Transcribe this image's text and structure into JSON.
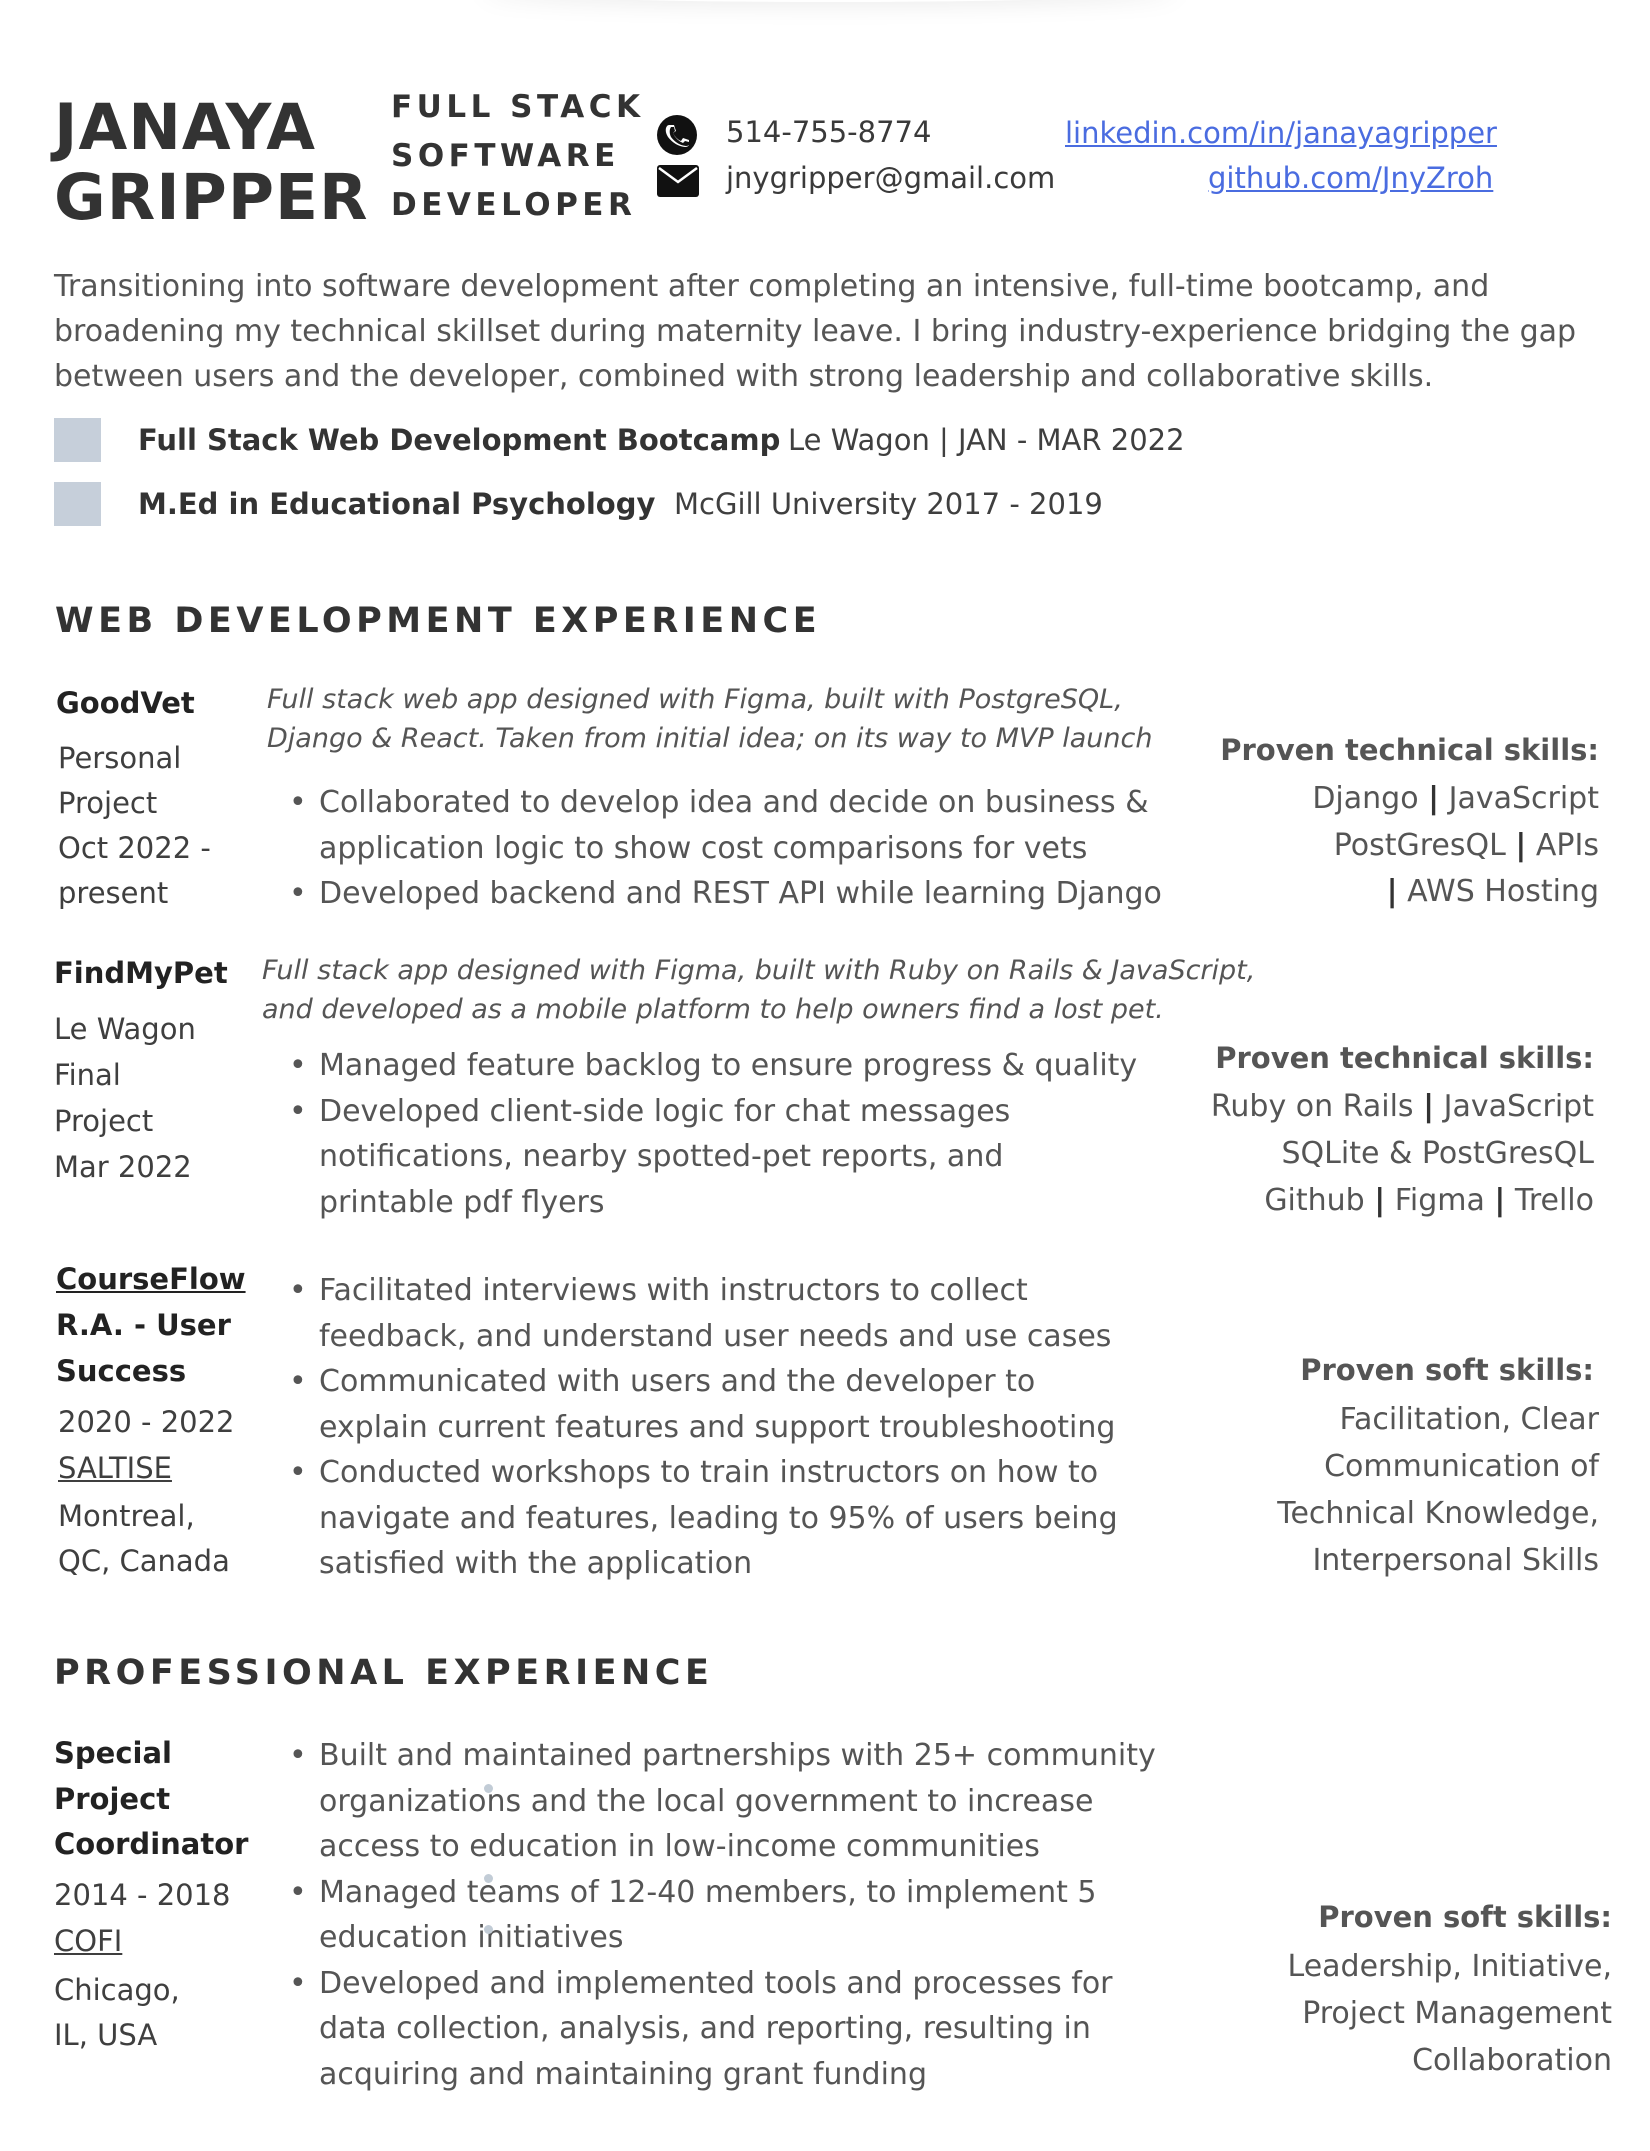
{
  "header": {
    "name_line1": "JANAYA",
    "name_line2": "GRIPPER",
    "role_line1": "FULL STACK",
    "role_line2": "SOFTWARE",
    "role_line3": "DEVELOPER",
    "phone": "514-755-8774",
    "email": "jnygripper@gmail.com",
    "linkedin": "linkedin.com/in/janayagripper",
    "github": "github.com/JnyZroh"
  },
  "summary": "Transitioning into software development after completing an intensive, full-time bootcamp, and broadening my technical skillset during maternity leave. I bring industry-experience bridging the gap between users and the developer, combined with strong leadership and collaborative skills.",
  "education": [
    {
      "title": "Full Stack Web Development Bootcamp",
      "meta": "Le Wagon | JAN - MAR 2022"
    },
    {
      "title": "M.Ed in Educational Psychology",
      "meta": "McGill University 2017 - 2019"
    }
  ],
  "web_section": {
    "heading": "WEB DEVELOPMENT EXPERIENCE",
    "jobs": [
      {
        "title": "GoodVet",
        "side": [
          "Personal",
          "Project",
          "Oct 2022 -",
          "present"
        ],
        "description": [
          "Full stack web app designed with Figma, built with PostgreSQL,",
          "Django & React. Taken from initial idea; on its way to MVP launch"
        ],
        "bullets": [
          [
            "Collaborated to develop idea and decide on business &",
            "application logic to show cost comparisons for vets"
          ],
          [
            "Developed backend and REST API while learning Django"
          ]
        ],
        "skills_heading": "Proven technical skills:",
        "skills": [
          [
            "Django",
            "JavaScript"
          ],
          [
            "PostGresQL",
            "APIs"
          ],
          [
            "AWS  Hosting"
          ]
        ]
      },
      {
        "title": "FindMyPet",
        "side": [
          "Le Wagon",
          "Final",
          "Project",
          "Mar 2022"
        ],
        "description": [
          "Full stack app designed with Figma, built with Ruby on Rails & JavaScript,",
          "and developed as a mobile platform to help owners find a lost pet."
        ],
        "bullets": [
          [
            "Managed feature backlog to ensure progress & quality"
          ],
          [
            "Developed client-side logic for chat messages",
            "notifications, nearby spotted-pet reports, and",
            "printable pdf flyers"
          ]
        ],
        "skills_heading": "Proven technical skills:",
        "skills": [
          [
            "Ruby on Rails",
            "JavaScript"
          ],
          [
            "SQLite & PostGresQL"
          ],
          [
            "Github",
            "Figma",
            "Trello"
          ]
        ]
      },
      {
        "title": "CourseFlow",
        "role": [
          "R.A. - User",
          "Success"
        ],
        "dates": "2020 - 2022",
        "org": "SALTISE",
        "location": [
          "Montreal,",
          "QC, Canada"
        ],
        "bullets": [
          [
            "Facilitated interviews with instructors to collect",
            "feedback, and understand user needs and use cases"
          ],
          [
            "Communicated with users and the developer to",
            "explain current features and support troubleshooting"
          ],
          [
            "Conducted workshops to train instructors on how to",
            "navigate and features, leading to 95% of users being",
            "satisfied with the application"
          ]
        ],
        "skills_heading": "Proven soft skills:",
        "skills_lines": [
          "Facilitation, Clear",
          "Communication of",
          "Technical Knowledge,",
          "Interpersonal Skills"
        ]
      }
    ]
  },
  "pro_section": {
    "heading": "PROFESSIONAL EXPERIENCE",
    "job": {
      "role": [
        "Special",
        "Project",
        "Coordinator"
      ],
      "dates": "2014 - 2018",
      "org": "COFI",
      "location": [
        "Chicago,",
        "IL, USA"
      ],
      "bullets": [
        [
          "Built and maintained partnerships with 25+ community",
          "organizations and the local government to increase",
          "access to education in low-income communities"
        ],
        [
          "Managed teams of 12-40 members, to implement 5",
          "education initiatives"
        ],
        [
          "Developed and implemented tools and processes for",
          "data collection, analysis, and reporting, resulting in",
          "acquiring and maintaining grant funding"
        ]
      ],
      "skills_heading": "Proven soft skills:",
      "skills_lines": [
        "Leadership, Initiative,",
        "Project Management",
        "Collaboration"
      ]
    }
  },
  "icons": {
    "phone": "phone-icon",
    "email": "envelope-icon"
  },
  "colors": {
    "link": "#4a6ce0",
    "edu_box": "#c6cfda",
    "text": "#555555",
    "heading": "#333333"
  }
}
